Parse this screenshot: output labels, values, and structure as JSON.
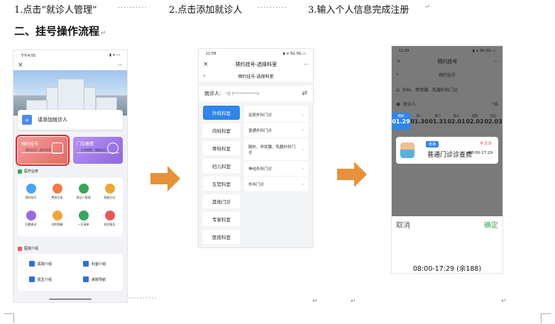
{
  "steps": {
    "step1": "1.点击“就诊人管理”",
    "step2": "2.点击添加就诊人",
    "step3": "3.输入个人信息完成注册",
    "dots": "··········",
    "para_mark": "↵"
  },
  "heading": "二、挂号操作流程",
  "phone1": {
    "status_time": "下午4:55",
    "status_icons": "▮ ≋ ▭",
    "close_glyph": "×",
    "menu_glyph": "···",
    "add_patient": "请添加就诊人",
    "plus_glyph": "+",
    "card_appointment": "预约挂号",
    "card_appointment_sub": "预约挂号 · 预约专家",
    "card_payment": "门诊缴费",
    "card_payment_sub": "在线缴费 · 便捷支付",
    "section_services": "医疗业务",
    "services": [
      "我的挂号",
      "费用记录",
      "就诊人管理",
      "智能分诊",
      "问题建议",
      "住院预缴",
      "一日清单",
      "检验报告"
    ],
    "service_colors": [
      "#4aa3f0",
      "#f07a4a",
      "#3aa55a",
      "#f0a53a",
      "#9a6ae0",
      "#f0a53a",
      "#3aa55a",
      "#e85a5a"
    ],
    "section_intro": "医院介绍",
    "intro_items": [
      "医院介绍",
      "科室介绍",
      "医生介绍",
      "来院导航"
    ]
  },
  "phone2": {
    "status_time": "11:59",
    "status_icons": "▮ ≋ 5G 5G ▭",
    "close_glyph": "×",
    "menu_glyph": "···",
    "title": "预约挂号-选择科室",
    "back_glyph": "‹",
    "sub_title": "预约挂号-选择科室",
    "patient_label": "就诊人:",
    "patient_value": "*浩  5*************9",
    "switch_glyph": "⇄",
    "departments": [
      "外科科室",
      "内科科室",
      "骨科科室",
      "妇儿科室",
      "五官科室",
      "其他门诊",
      "专家科室",
      "医技科室"
    ],
    "active_index": 0,
    "sub_departments": [
      "泌尿外科门诊",
      "普通外科门诊",
      "胸外、甲状腺、乳腺外科门诊",
      "神经外科门诊",
      "外科门诊"
    ],
    "chev_glyph": "›"
  },
  "phone3": {
    "status_time": "11:59",
    "status_icons": "▮ ≋ 5G 5G ▭",
    "close_glyph": "×",
    "menu_glyph": "···",
    "title": "预约挂号",
    "back_glyph": "‹",
    "dept_name": "外科、甲状腺、乳腺外科门诊",
    "patient_label": "就诊人",
    "patient_value": "*浩",
    "weekdays": [
      "周四",
      "周一",
      "周二",
      "周三",
      "周四",
      "周五"
    ],
    "dates": [
      "01.29",
      "01.30",
      "01.31",
      "02.01",
      "02.02",
      "02.03"
    ],
    "active_date": 0,
    "tag": "普通",
    "price": "¥ 3.9",
    "service": "普通门诊诊查费",
    "service_time": "08:00-17:29",
    "cancel": "取消",
    "confirm": "确定",
    "slot": "08:00-17:29 (余188)"
  },
  "colors": {
    "arrow": "#e8913a",
    "primary": "#2f86e8",
    "highlight": "#e82020",
    "confirm": "#3aa55a"
  }
}
